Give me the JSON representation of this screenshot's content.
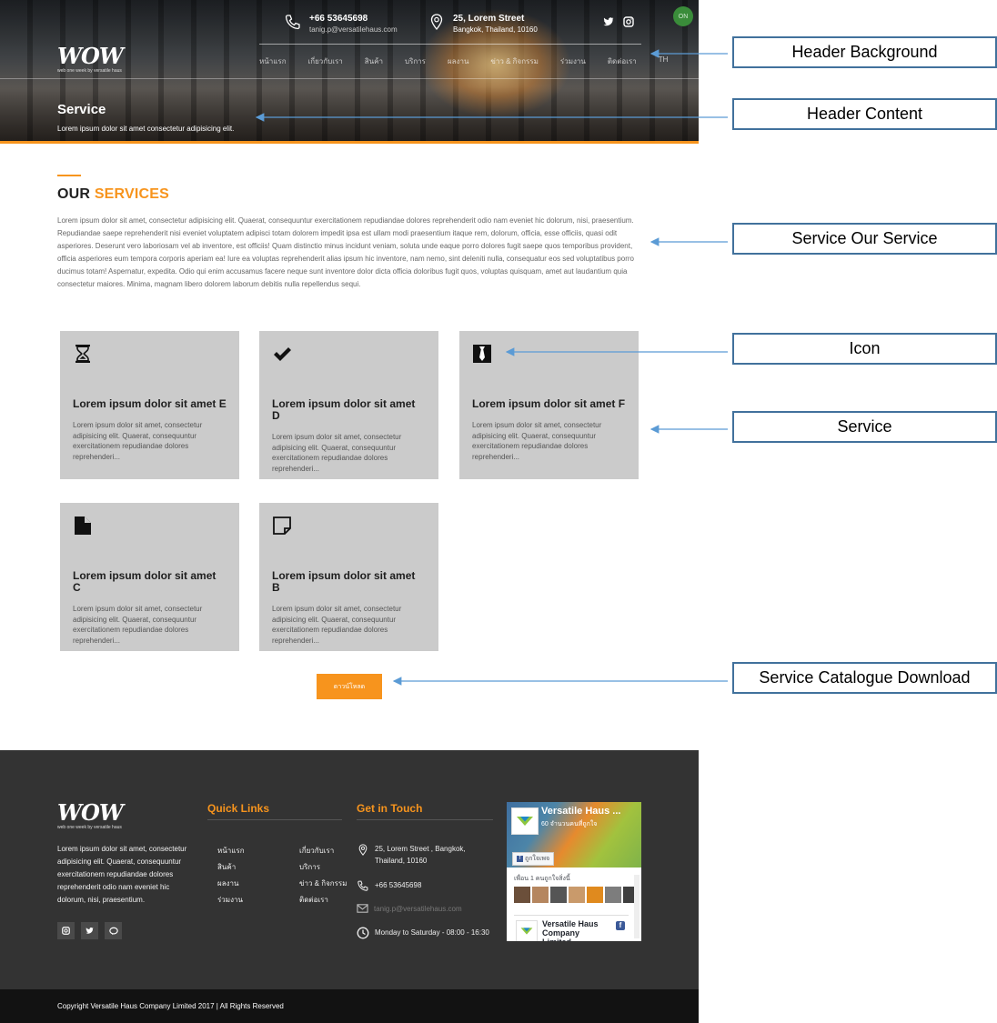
{
  "header": {
    "phone": "+66 53645698",
    "email": "tanig.p@versatilehaus.com",
    "address_line1": "25, Lorem Street",
    "address_line2": "Bangkok, Thailand, 10160",
    "logo_text": "WOW",
    "logo_tagline": "web one week by versatile haus",
    "nav": [
      "หน้าแรก",
      "เกี่ยวกับเรา",
      "สินค้า",
      "บริการ",
      "ผลงาน",
      "ข่าว & กิจกรรม",
      "ร่วมงาน",
      "ติดต่อเรา",
      "TH"
    ],
    "lang_badge": "ON",
    "page_title": "Service",
    "page_subtitle": "Lorem ipsum dolor sit amet consectetur adipisicing elit."
  },
  "our_services": {
    "heading_prefix": "OUR",
    "heading_highlight": "SERVICES",
    "intro": "Lorem ipsum dolor sit amet, consectetur adipisicing elit. Quaerat, consequuntur exercitationem repudiandae dolores reprehenderit odio nam eveniet hic dolorum, nisi, praesentium. Repudiandae saepe reprehenderit nisi eveniet voluptatem adipisci totam dolorem impedit ipsa est ullam modi praesentium itaque rem, dolorum, officia, esse officiis, quasi odit asperiores. Deserunt vero laboriosam vel ab inventore, est officiis! Quam distinctio minus incidunt veniam, soluta unde eaque porro dolores fugit saepe quos temporibus provident, officia asperiores eum tempora corporis aperiam ea! Iure ea voluptas reprehenderit alias ipsum hic inventore, nam nemo, sint deleniti nulla, consequatur eos sed voluptatibus porro ducimus totam! Aspernatur, expedita. Odio qui enim accusamus facere neque sunt inventore dolor dicta officia doloribus fugit quos, voluptas quisquam, amet aut laudantium quia consectetur maiores. Minima, magnam libero dolorem laborum debitis nulla repellendus sequi."
  },
  "services": [
    {
      "icon": "hourglass-icon",
      "title": "Lorem ipsum dolor sit amet E",
      "text": "Lorem ipsum dolor sit amet, consectetur adipisicing elit. Quaerat, consequuntur exercitationem repudiandae dolores reprehenderi..."
    },
    {
      "icon": "checkmark-icon",
      "title": "Lorem ipsum dolor sit amet D",
      "text": "Lorem ipsum dolor sit amet, consectetur adipisicing elit. Quaerat, consequuntur exercitationem repudiandae dolores reprehenderi..."
    },
    {
      "icon": "tie-icon",
      "title": "Lorem ipsum dolor sit amet F",
      "text": "Lorem ipsum dolor sit amet, consectetur adipisicing elit. Quaerat, consequuntur exercitationem repudiandae dolores reprehenderi..."
    },
    {
      "icon": "document-icon",
      "title": "Lorem ipsum dolor sit amet C",
      "text": "Lorem ipsum dolor sit amet, consectetur adipisicing elit. Quaerat, consequuntur exercitationem repudiandae dolores reprehenderi..."
    },
    {
      "icon": "sticky-note-icon",
      "title": "Lorem ipsum dolor sit amet B",
      "text": "Lorem ipsum dolor sit amet, consectetur adipisicing elit. Quaerat, consequuntur exercitationem repudiandae dolores reprehenderi..."
    }
  ],
  "download_button": "ดาวน์โหลด",
  "footer": {
    "logo_text": "WOW",
    "logo_tagline": "web one week by versatile haus",
    "about": "Lorem ipsum dolor sit amet, consectetur adipisicing elit. Quaerat, consequuntur exercitationem repudiandae dolores reprehenderit odio nam eveniet hic dolorum, nisi, praesentium.",
    "quick_links_title": "Quick Links",
    "quick_links_col1": [
      "หน้าแรก",
      "สินค้า",
      "ผลงาน",
      "ร่วมงาน"
    ],
    "quick_links_col2": [
      "เกี่ยวกับเรา",
      "บริการ",
      "ข่าว & กิจกรรม",
      "ติดต่อเรา"
    ],
    "get_in_touch_title": "Get in Touch",
    "touch_address": "25, Lorem Street , Bangkok, Thailand, 10160",
    "touch_phone": "+66 53645698",
    "touch_email": "tanig.p@versatilehaus.com",
    "touch_hours": "Monday to Saturday - 08:00 - 16:30",
    "fb_page_name": "Versatile Haus ...",
    "fb_likes": "60 จำนวนคนที่ถูกใจ",
    "fb_like_button": "ถูกใจเพจ",
    "fb_friends": "เพื่อน 1 คนถูกใจสิ่งนี้",
    "fb_post_name": "Versatile Haus Company Limited",
    "copyright": "Copyright Versatile Haus Company Limited 2017 | All Rights Reserved"
  },
  "annotations": [
    "Header Background",
    "Header Content",
    "Service Our Service",
    "Icon",
    "Service",
    "Service Catalogue Download"
  ],
  "colors": {
    "accent": "#f7941d",
    "footer_bg": "#333333",
    "card_bg": "#cbcbcb",
    "annotation_border": "#41719c"
  }
}
